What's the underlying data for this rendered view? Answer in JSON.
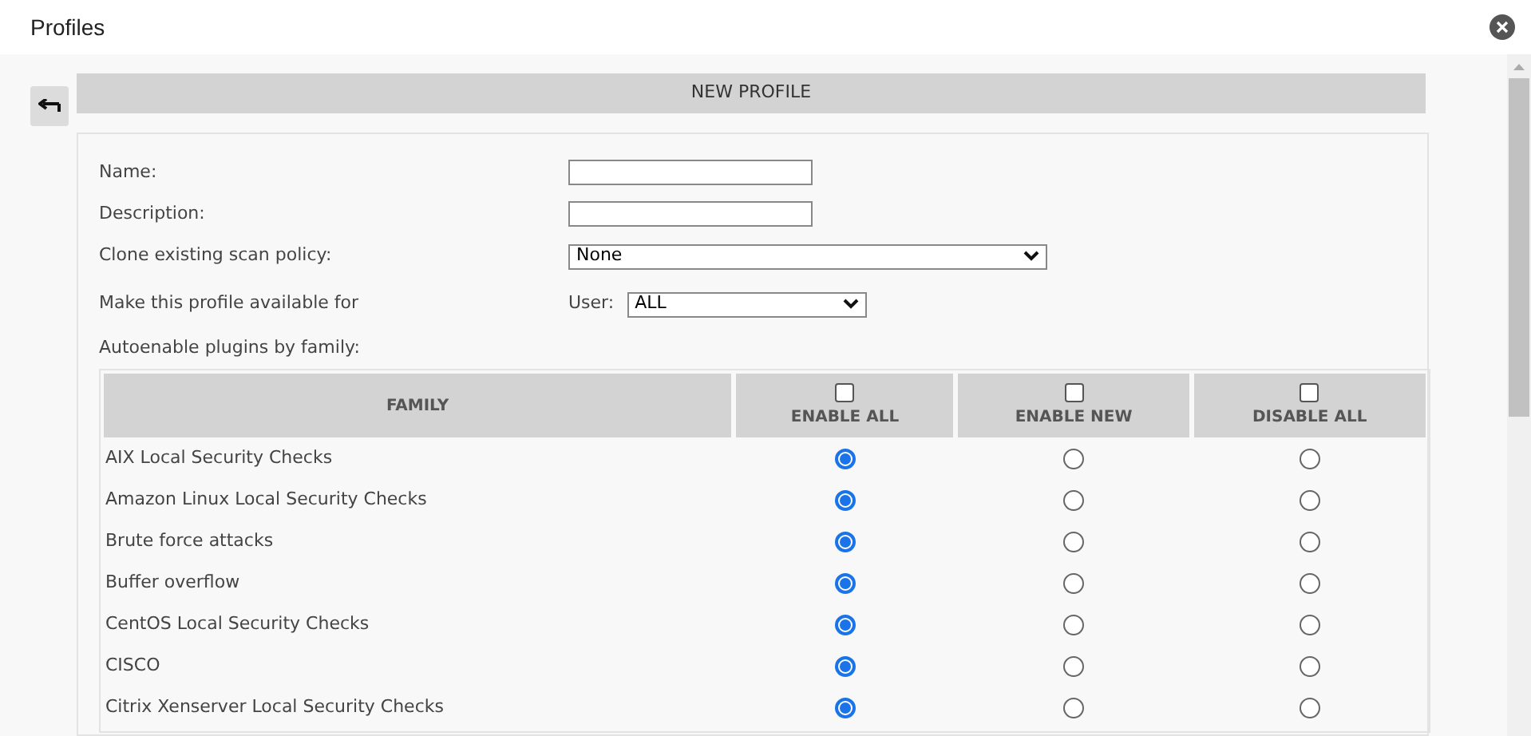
{
  "window": {
    "title": "Profiles"
  },
  "panel": {
    "title": "NEW PROFILE"
  },
  "form": {
    "fields": [
      {
        "kind": "text",
        "label": "Name:"
      },
      {
        "kind": "text",
        "label": "Description:"
      },
      {
        "kind": "select",
        "label": "Clone existing scan policy:",
        "value": "None"
      },
      {
        "kind": "user-select",
        "label": "Make this profile available for",
        "sublabel": "User:",
        "value": "ALL"
      },
      {
        "kind": "note",
        "label": "Autoenable plugins by family:"
      }
    ]
  },
  "table": {
    "family_column": "FAMILY",
    "columns": [
      {
        "label": "ENABLE ALL",
        "checked": false
      },
      {
        "label": "ENABLE NEW",
        "checked": false
      },
      {
        "label": "DISABLE ALL",
        "checked": false
      }
    ],
    "rows": [
      {
        "family": "AIX Local Security Checks",
        "options": [
          {
            "selected": true
          },
          {
            "selected": false
          },
          {
            "selected": false
          }
        ]
      },
      {
        "family": "Amazon Linux Local Security Checks",
        "options": [
          {
            "selected": true
          },
          {
            "selected": false
          },
          {
            "selected": false
          }
        ]
      },
      {
        "family": "Brute force attacks",
        "options": [
          {
            "selected": true
          },
          {
            "selected": false
          },
          {
            "selected": false
          }
        ]
      },
      {
        "family": "Buffer overflow",
        "options": [
          {
            "selected": true
          },
          {
            "selected": false
          },
          {
            "selected": false
          }
        ]
      },
      {
        "family": "CentOS Local Security Checks",
        "options": [
          {
            "selected": true
          },
          {
            "selected": false
          },
          {
            "selected": false
          }
        ]
      },
      {
        "family": "CISCO",
        "options": [
          {
            "selected": true
          },
          {
            "selected": false
          },
          {
            "selected": false
          }
        ]
      },
      {
        "family": "Citrix Xenserver Local Security Checks",
        "options": [
          {
            "selected": true
          },
          {
            "selected": false
          },
          {
            "selected": false
          }
        ]
      }
    ]
  }
}
